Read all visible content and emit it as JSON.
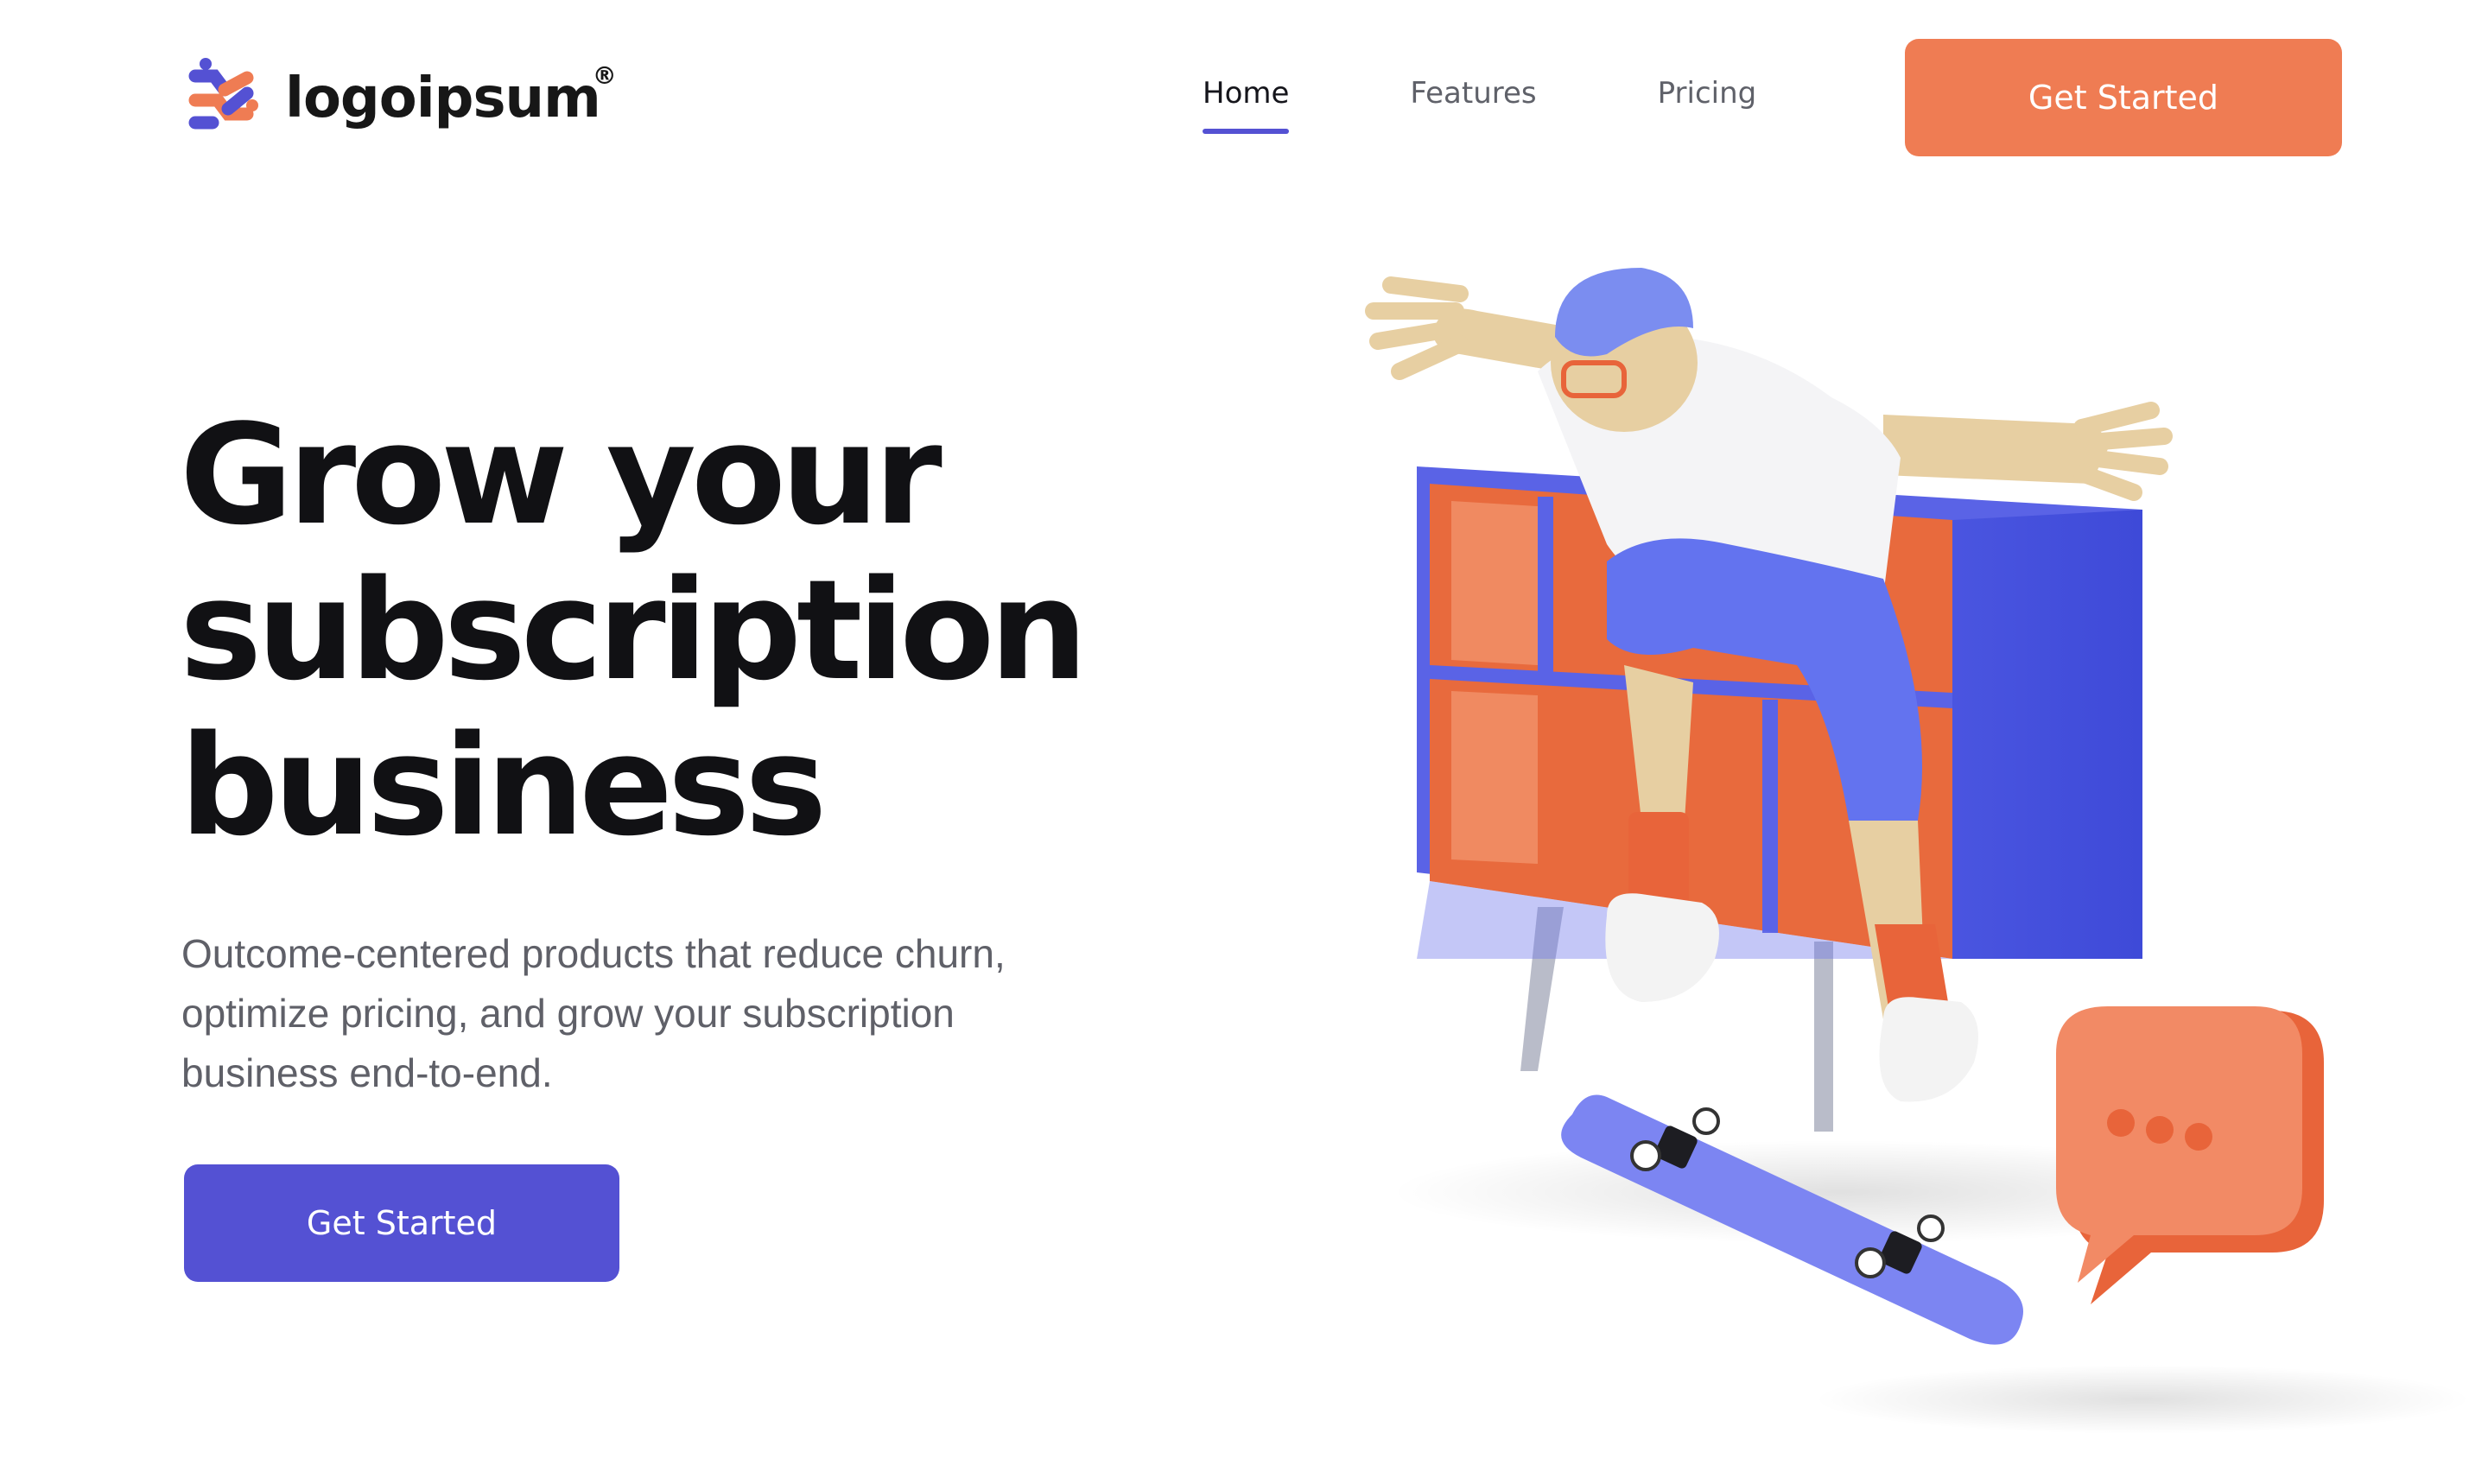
{
  "brand": {
    "name": "logoipsum",
    "mark": "®",
    "colors": {
      "orange": "#ef7c53",
      "purple": "#5451d3"
    }
  },
  "nav": {
    "items": [
      {
        "label": "Home",
        "active": true
      },
      {
        "label": "Features",
        "active": false
      },
      {
        "label": "Pricing",
        "active": false
      }
    ],
    "cta_label": "Get Started"
  },
  "hero": {
    "title_lines": [
      "Grow your",
      "subscription",
      "business"
    ],
    "subtitle_lines": [
      "Outcome-centered products that reduce churn,",
      "optimize pricing, and grow your subscription",
      "business end-to-end."
    ],
    "cta_label": "Get Started"
  },
  "illustration": {
    "subject": "3D skateboarder jumping over shelf with chat bubble"
  }
}
